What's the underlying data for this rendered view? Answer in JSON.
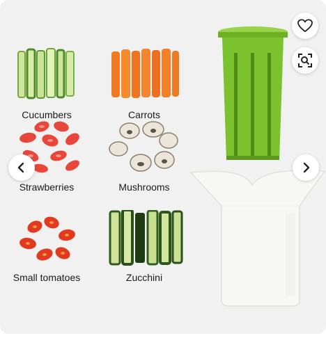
{
  "gallery": {
    "items": [
      {
        "label": "Cucumbers"
      },
      {
        "label": "Carrots"
      },
      {
        "label": "Strawberries"
      },
      {
        "label": "Mushrooms"
      },
      {
        "label": "Small tomatoes"
      },
      {
        "label": "Zucchini"
      }
    ],
    "icons": {
      "favorite": "heart-icon",
      "visual_search": "image-search-icon",
      "previous": "chevron-left-icon",
      "next": "chevron-right-icon"
    },
    "colors": {
      "background": "#f1f1f1",
      "cutter_green": "#7cc22e",
      "body_white": "#f7f7f5"
    }
  }
}
